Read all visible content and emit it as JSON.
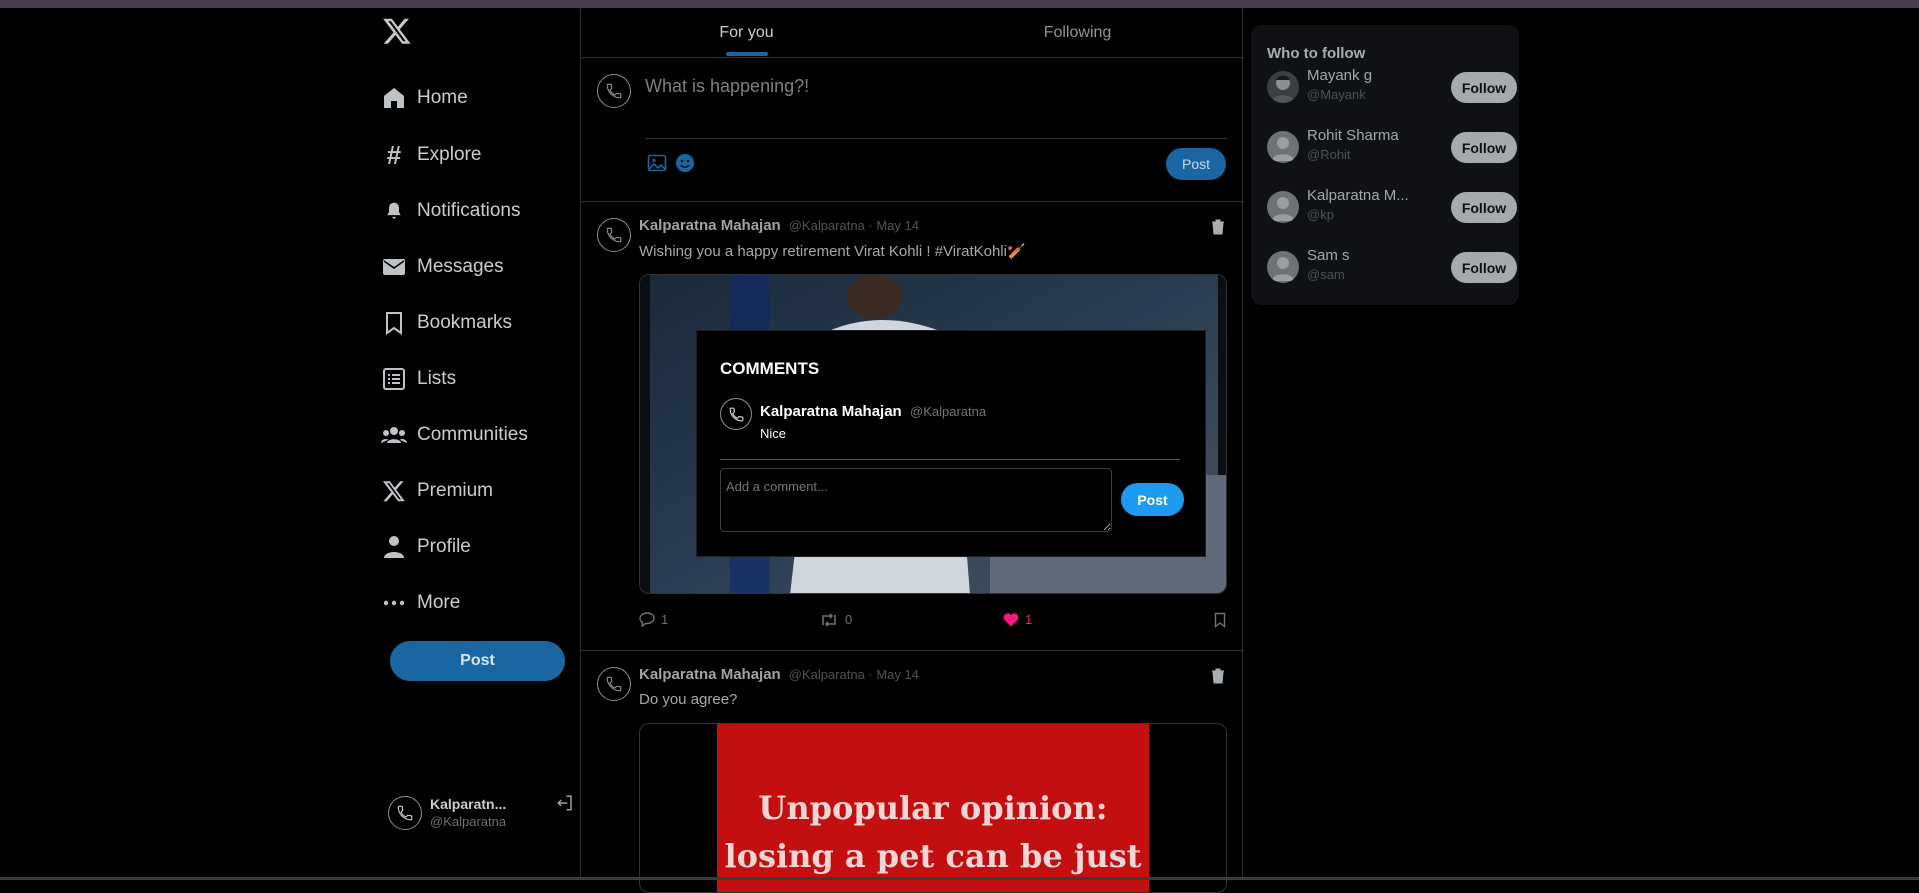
{
  "sidebar": {
    "logo": "x-logo",
    "items": [
      {
        "label": "Home",
        "icon": "home-icon"
      },
      {
        "label": "Explore",
        "icon": "hashtag-icon"
      },
      {
        "label": "Notifications",
        "icon": "bell-icon"
      },
      {
        "label": "Messages",
        "icon": "envelope-icon"
      },
      {
        "label": "Bookmarks",
        "icon": "bookmark-icon"
      },
      {
        "label": "Lists",
        "icon": "list-icon"
      },
      {
        "label": "Communities",
        "icon": "people-icon"
      },
      {
        "label": "Premium",
        "icon": "x-icon"
      },
      {
        "label": "Profile",
        "icon": "user-icon"
      },
      {
        "label": "More",
        "icon": "dots-icon"
      }
    ],
    "post_label": "Post",
    "account": {
      "name": "Kalparatn...",
      "handle": "@Kalparatna"
    }
  },
  "tabs": [
    {
      "label": "For you",
      "active": true
    },
    {
      "label": "Following",
      "active": false
    }
  ],
  "composer": {
    "placeholder": "What is happening?!",
    "post_label": "Post"
  },
  "tweets": [
    {
      "name": "Kalparatna Mahajan",
      "meta": "@Kalparatna · May 14",
      "text": "Wishing you a happy retirement Virat Kohli ! #ViratKohli🏏",
      "comments": "1",
      "retweets": "0",
      "likes": "1"
    },
    {
      "name": "Kalparatna Mahajan",
      "meta": "@Kalparatna · May 14",
      "text": "Do you agree?",
      "image_text_line1": "Unpopular opinion:",
      "image_text_line2": "losing a pet can be just"
    }
  ],
  "who_to_follow": {
    "title": "Who to follow",
    "follow_label": "Follow",
    "users": [
      {
        "name": "Mayank g",
        "handle": "@Mayank"
      },
      {
        "name": "Rohit Sharma",
        "handle": "@Rohit"
      },
      {
        "name": "Kalparatna M...",
        "handle": "@kp"
      },
      {
        "name": "Sam s",
        "handle": "@sam"
      }
    ]
  },
  "comments_modal": {
    "title": "COMMENTS",
    "comment": {
      "name": "Kalparatna Mahajan",
      "handle": "@Kalparatna",
      "text": "Nice"
    },
    "input_placeholder": "Add a comment...",
    "post_label": "Post"
  },
  "colors": {
    "accent": "#1d9bf0",
    "accent_dim": "#1a66a3",
    "like": "#f91880"
  }
}
